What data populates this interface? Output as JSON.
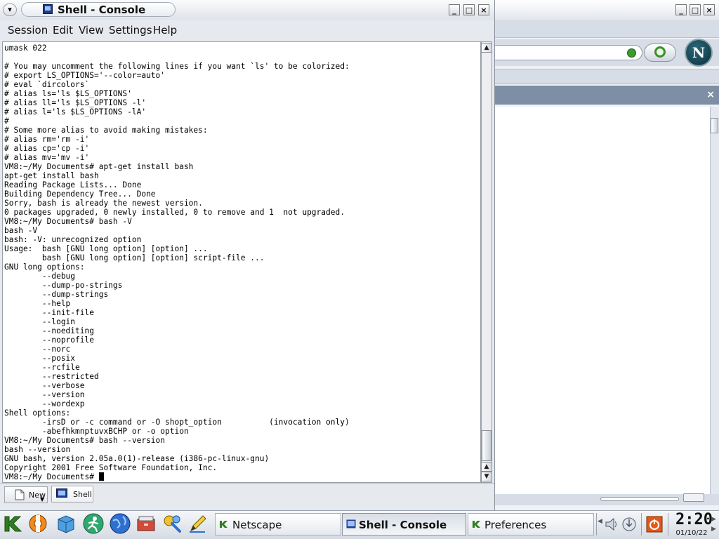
{
  "konsole": {
    "title": "Shell - Console",
    "window_buttons": [
      "_",
      "□",
      "×"
    ],
    "menu": [
      "Session",
      "Edit",
      "View",
      "Settings",
      "Help"
    ],
    "terminal_lines": [
      "umask 022",
      "",
      "# You may uncomment the following lines if you want `ls' to be colorized:",
      "# export LS_OPTIONS='--color=auto'",
      "# eval `dircolors`",
      "# alias ls='ls $LS_OPTIONS'",
      "# alias ll='ls $LS_OPTIONS -l'",
      "# alias l='ls $LS_OPTIONS -lA'",
      "#",
      "# Some more alias to avoid making mistakes:",
      "# alias rm='rm -i'",
      "# alias cp='cp -i'",
      "# alias mv='mv -i'",
      "VM8:~/My Documents# apt-get install bash",
      "apt-get install bash",
      "Reading Package Lists... Done",
      "Building Dependency Tree... Done",
      "Sorry, bash is already the newest version.",
      "0 packages upgraded, 0 newly installed, 0 to remove and 1  not upgraded.",
      "VM8:~/My Documents# bash -V",
      "bash -V",
      "bash: -V: unrecognized option",
      "Usage:  bash [GNU long option] [option] ...",
      "        bash [GNU long option] [option] script-file ...",
      "GNU long options:",
      "        --debug",
      "        --dump-po-strings",
      "        --dump-strings",
      "        --help",
      "        --init-file",
      "        --login",
      "        --noediting",
      "        --noprofile",
      "        --norc",
      "        --posix",
      "        --rcfile",
      "        --restricted",
      "        --verbose",
      "        --version",
      "        --wordexp",
      "Shell options:",
      "        -irsD or -c command or -O shopt_option          (invocation only)",
      "        -abefhkmnptuvxBCHP or -o option",
      "VM8:~/My Documents# bash --version",
      "bash --version",
      "GNU bash, version 2.05a.0(1)-release (i386-pc-linux-gnu)",
      "Copyright 2001 Free Software Foundation, Inc."
    ],
    "prompt": "VM8:~/My Documents# ",
    "tabs": {
      "new_label": "New",
      "shell_label": "Shell"
    }
  },
  "background_window": {
    "logo_letter": "N",
    "close": "×"
  },
  "taskbar": {
    "quick_launch": [
      "kde-menu-icon",
      "lifebuoy-icon",
      "package-box-icon",
      "running-man-icon",
      "globe-icon",
      "archive-drawer-icon",
      "tools-icon",
      "pen-icon"
    ],
    "tasks": [
      {
        "label": "Netscape",
        "active": false
      },
      {
        "label": "Shell - Console",
        "active": true
      },
      {
        "label": "Preferences",
        "active": false
      }
    ],
    "clock_time": "2:20",
    "clock_date": "01/10/22"
  },
  "colors": {
    "accent": "#1a3d8f",
    "terminal_bg": "#ffffff",
    "sidebar_head": "#7e8fa5"
  }
}
